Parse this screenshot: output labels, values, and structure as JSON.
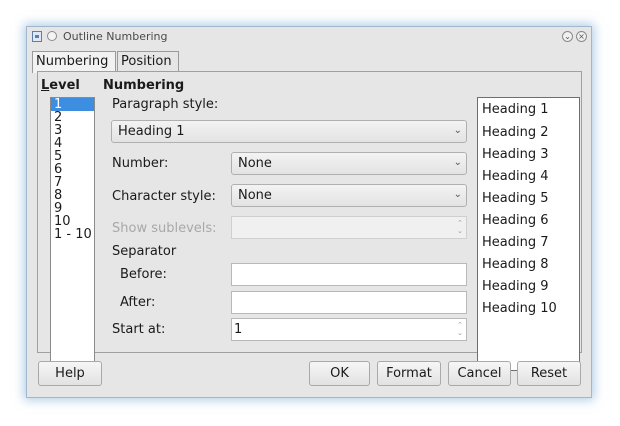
{
  "window": {
    "title": "Outline Numbering"
  },
  "tabs": [
    {
      "label": "Numbering",
      "active": true
    },
    {
      "label": "Position",
      "active": false
    }
  ],
  "level": {
    "title": "Level",
    "title_mnemonic": "L",
    "items": [
      "1",
      "2",
      "3",
      "4",
      "5",
      "6",
      "7",
      "8",
      "9",
      "10",
      "1 - 10"
    ],
    "selected": "1"
  },
  "numbering": {
    "title": "Numbering",
    "paragraph_style_label": "Paragraph style:",
    "paragraph_style_value": "Heading 1",
    "number_label": "Number:",
    "number_value": "None",
    "character_style_label": "Character style:",
    "character_style_value": "None",
    "show_sublevels_label": "Show sublevels:",
    "show_sublevels_value": "",
    "separator_label": "Separator",
    "before_label": "Before:",
    "before_value": "",
    "after_label": "After:",
    "after_value": "",
    "start_at_label": "Start at:",
    "start_at_value": "1"
  },
  "preview": [
    "Heading 1",
    "Heading 2",
    "Heading 3",
    "Heading 4",
    "Heading 5",
    "Heading 6",
    "Heading 7",
    "Heading 8",
    "Heading 9",
    "Heading 10"
  ],
  "buttons": {
    "help": "Help",
    "ok": "OK",
    "format": "Format",
    "cancel": "Cancel",
    "reset": "Reset"
  },
  "colors": {
    "selection": "#3d8ee0",
    "window_glow": "#6ea0d2"
  }
}
